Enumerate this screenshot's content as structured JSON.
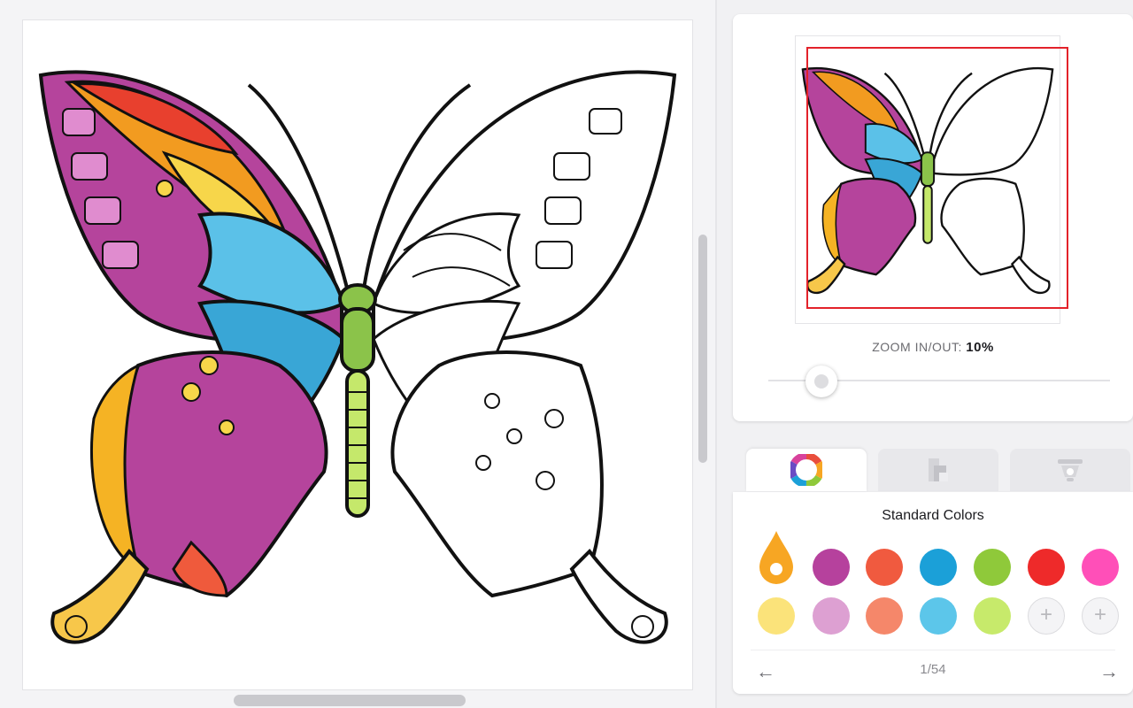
{
  "canvas": {
    "image_name": "butterfly coloring page"
  },
  "navigator": {
    "zoom_label": "ZOOM IN/OUT:",
    "zoom_value": "10%",
    "zoom_level_percent": 10
  },
  "tabs": [
    {
      "icon": "color-wheel-icon",
      "active": true
    },
    {
      "icon": "gradient-icon",
      "active": false
    },
    {
      "icon": "bucket-icon",
      "active": false
    }
  ],
  "palette": {
    "title": "Standard Colors",
    "selected_color": "#f7a623",
    "row1": [
      "#f7a623",
      "#b6419d",
      "#f05a3f",
      "#1ba0d8",
      "#8fc93a",
      "#ee2a2a",
      "#ff4fb8"
    ],
    "row2": [
      "#fbe37a",
      "#dda0d2",
      "#f5876a",
      "#5cc6ea",
      "#c7ea6b",
      "add",
      "add"
    ],
    "add_label": "+",
    "page": "1/54",
    "prev": "←",
    "next": "→"
  },
  "accent_colors": {
    "viewport": "#e3222a",
    "butterfly_body": "#8bc34a"
  }
}
